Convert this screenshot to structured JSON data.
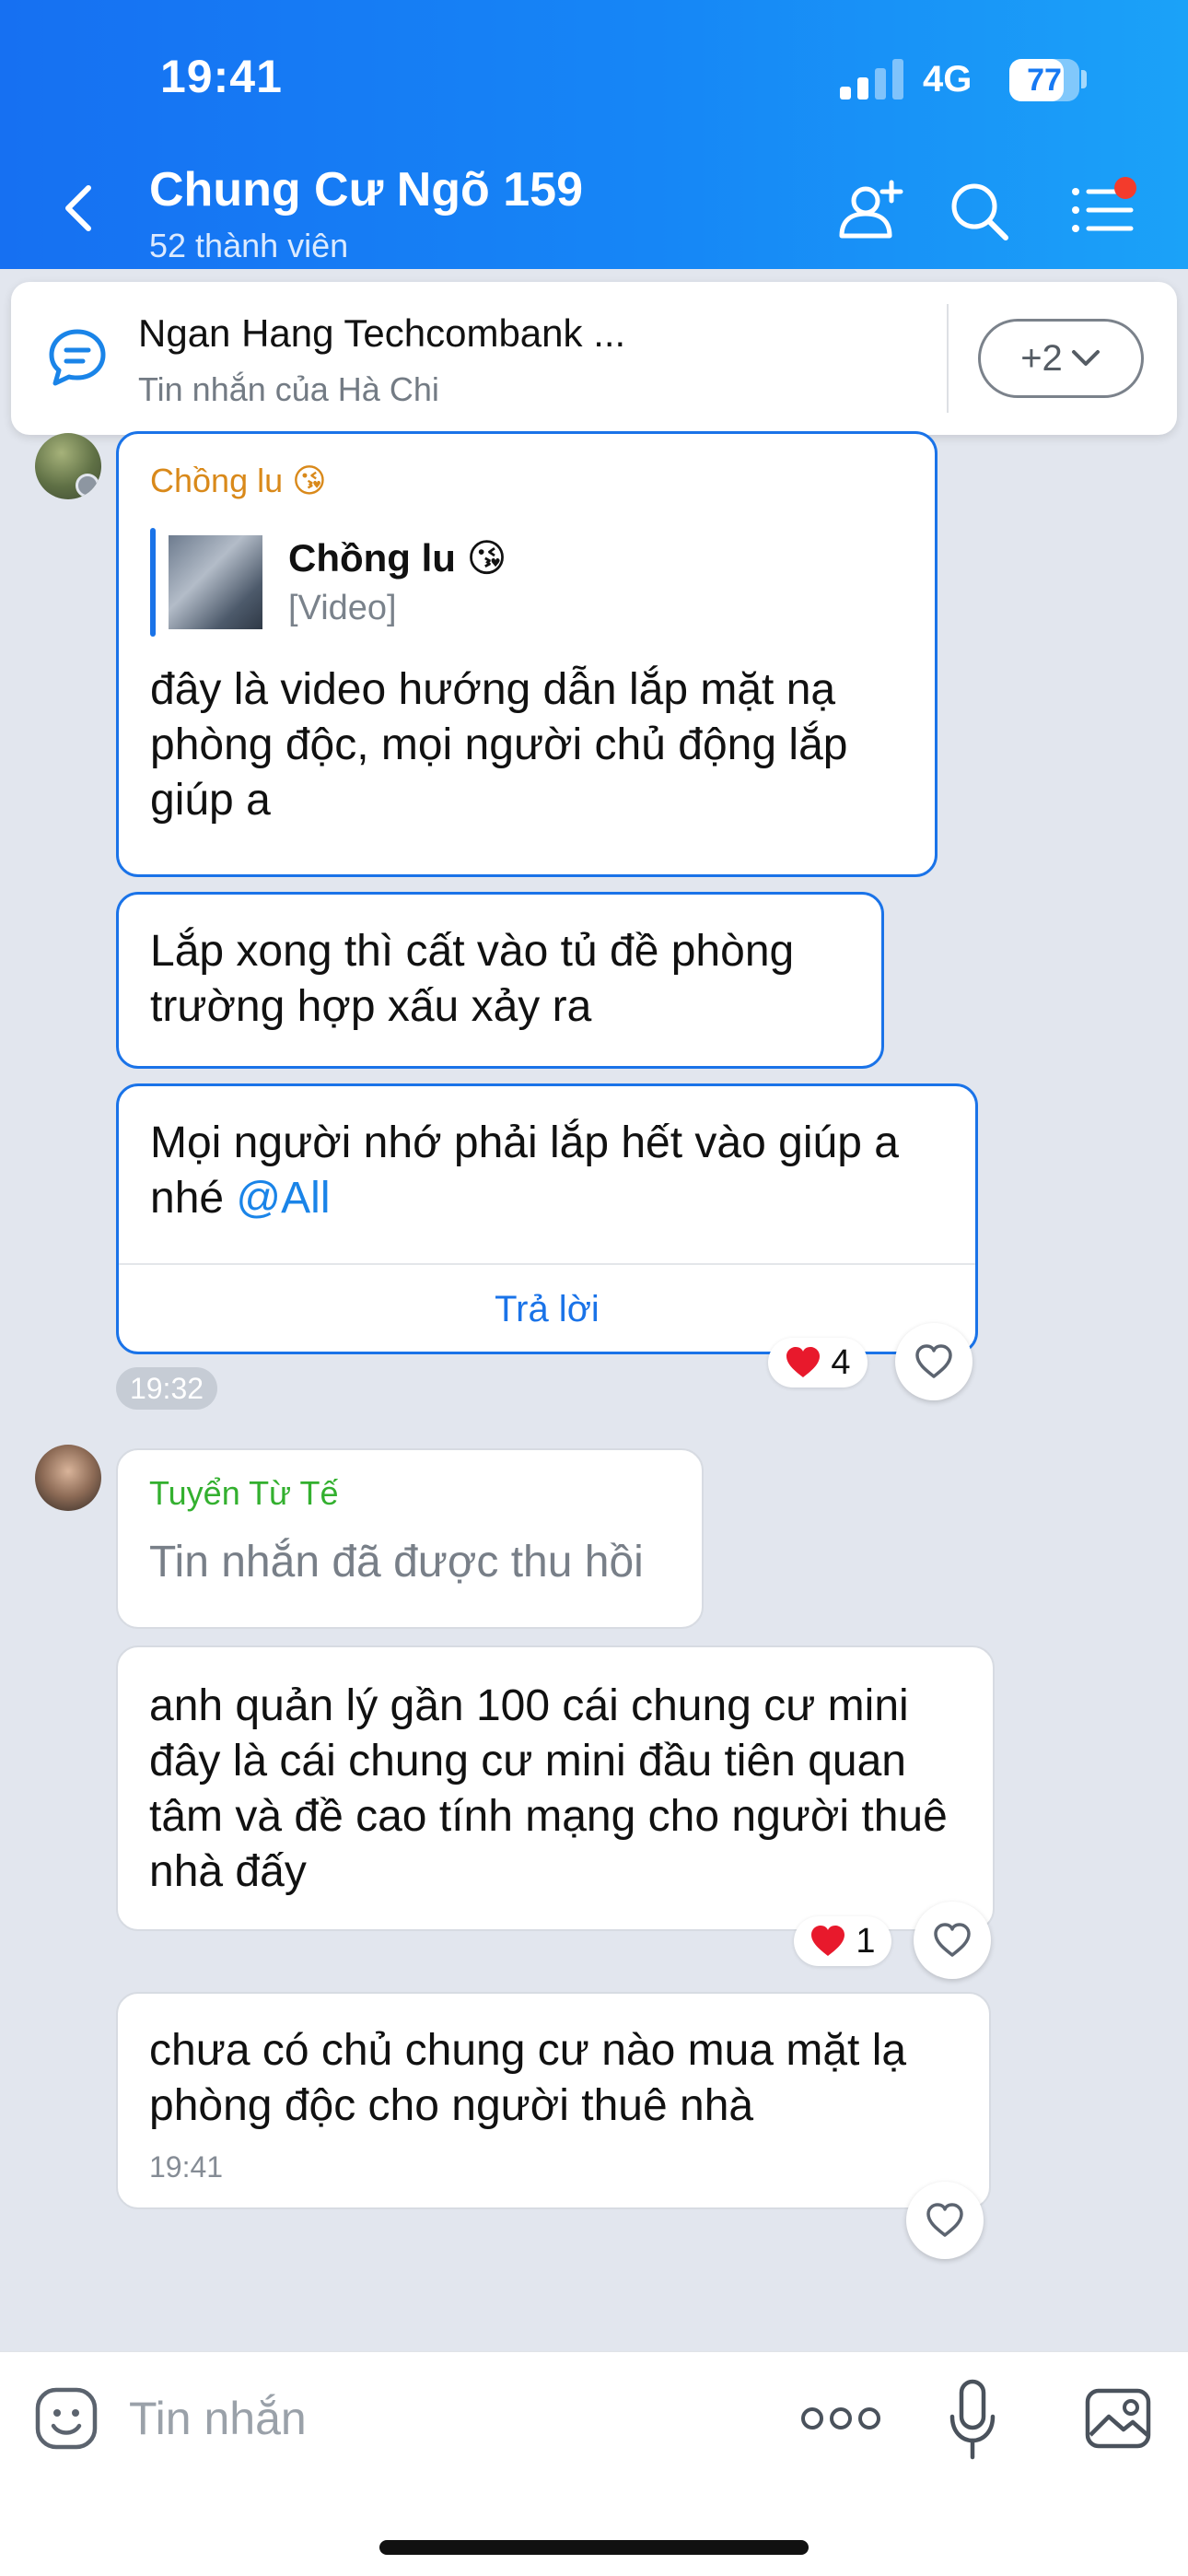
{
  "status_bar": {
    "time": "19:41",
    "network": "4G",
    "battery": "77",
    "battery_level_percent": 77
  },
  "header": {
    "title": "Chung Cư Ngõ 159",
    "subtitle": "52 thành viên",
    "icons": [
      "back-icon",
      "add-member-icon",
      "search-icon",
      "menu-icon"
    ],
    "menu_notification": true
  },
  "pinned": {
    "title": "Ngan Hang Techcombank ...",
    "subtitle": "Tin nhắn của Hà Chi",
    "more_label": "+2"
  },
  "messages": [
    {
      "sender": "Chồng lu 😘",
      "quote": {
        "name": "Chồng lu 😘",
        "type": "[Video]"
      },
      "text": "đây là video hướng dẫn lắp mặt nạ phòng độc, mọi người chủ động lắp giúp a"
    },
    {
      "text": "Lắp xong thì cất vào tủ đề phòng trường hợp xấu xảy ra"
    },
    {
      "text": "Mọi người nhớ phải lắp hết vào giúp a nhé ",
      "mention": "@All",
      "reply_label": "Trả lời",
      "reaction_count": "4",
      "time": "19:32"
    },
    {
      "sender": "Tuyển Từ Tế",
      "text": "Tin nhắn đã được thu hồi"
    },
    {
      "text": "anh quản lý gần 100 cái chung cư mini đây là cái chung cư mini đầu tiên quan tâm và đề cao tính mạng cho người thuê nhà đấy",
      "reaction_count": "1"
    },
    {
      "text": "chưa có chủ chung cư nào mua mặt lạ phòng độc cho người thuê nhà",
      "time": "19:41"
    }
  ],
  "input": {
    "placeholder": "Tin nhắn"
  },
  "colors": {
    "header": "#1679f3",
    "accent": "#1a73e8",
    "sender_orange": "#d9891a",
    "sender_green": "#33b02f",
    "heart": "#e8192c",
    "chat_bg": "#e2e6ee"
  }
}
